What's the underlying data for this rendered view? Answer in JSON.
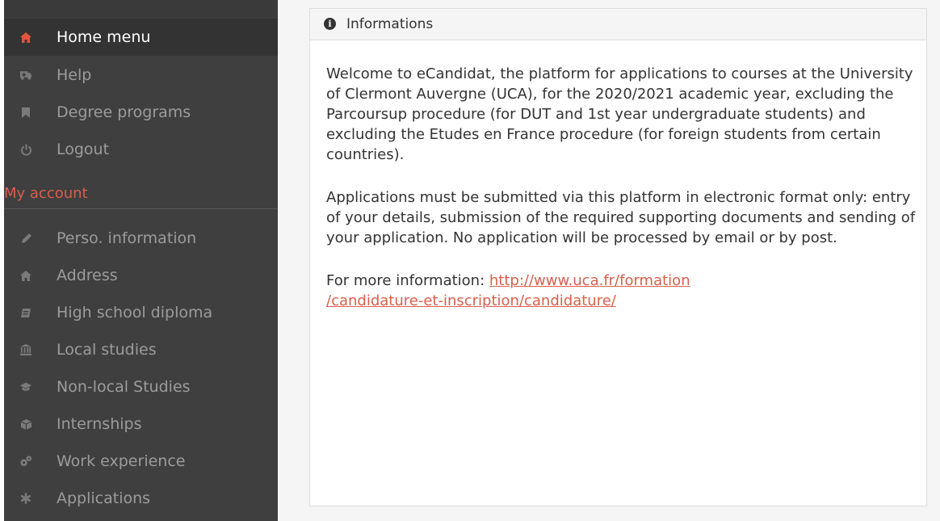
{
  "sidebar": {
    "items": [
      {
        "label": "Home menu",
        "icon": "home-icon",
        "active": true
      },
      {
        "label": "Help",
        "icon": "ambulance-icon"
      },
      {
        "label": "Degree programs",
        "icon": "bookmark-icon"
      },
      {
        "label": "Logout",
        "icon": "power-icon"
      }
    ],
    "section_title": "My account",
    "account_items": [
      {
        "label": "Perso. information",
        "icon": "pencil-icon"
      },
      {
        "label": "Address",
        "icon": "home-icon"
      },
      {
        "label": "High school diploma",
        "icon": "book-icon"
      },
      {
        "label": "Local studies",
        "icon": "institution-icon"
      },
      {
        "label": "Non-local Studies",
        "icon": "graduation-cap-icon"
      },
      {
        "label": "Internships",
        "icon": "cube-icon"
      },
      {
        "label": "Work experience",
        "icon": "cogs-icon"
      },
      {
        "label": "Applications",
        "icon": "asterisk-icon"
      }
    ]
  },
  "panel": {
    "title": "Informations",
    "paragraph1": "Welcome to eCandidat, the platform for applications to courses at the University of Clermont Auvergne (UCA), for the 2020/2021 academic year, excluding the Parcoursup procedure (for DUT and 1st year undergraduate students) and excluding the Etudes en France procedure (for foreign students from certain countries).",
    "paragraph2": "Applications must be submitted via this platform in electronic format only: entry of your details, submission of the required supporting documents and sending of your application. No application will be processed by email or by post.",
    "more_info_label": "For more information:",
    "more_info_link_line1": "http://www.uca.fr/formation",
    "more_info_link_line2": "/candidature-et-inscription/candidature/"
  },
  "colors": {
    "sidebar_bg": "#3f3f3f",
    "accent": "#d85f4b"
  }
}
